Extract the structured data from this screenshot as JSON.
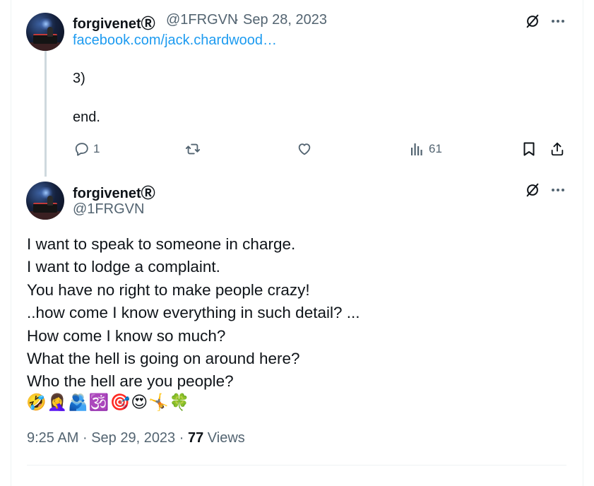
{
  "reply_tweet": {
    "display_name": "forgivenetⓇ",
    "handle": "@1FRGVN",
    "separator": "·",
    "date": "Sep 28, 2023",
    "link": "facebook.com/jack.chardwood…",
    "lines": [
      "3)",
      "end."
    ],
    "actions": {
      "replies": "1",
      "retweets": "",
      "likes": "",
      "views": "61"
    }
  },
  "main_tweet": {
    "display_name": "forgivenetⓇ",
    "handle": "@1FRGVN",
    "lines": [
      "I want to speak to someone in charge.",
      "I want to lodge a complaint.",
      "You have no right to make people crazy!",
      "..how come I know everything in such detail?   ...",
      "How come I know so much?",
      "What the hell is going on around here?",
      "Who the hell are  you people?"
    ],
    "emojis": "🤣🤦‍♀️🫂🕉️🎯😍🤸🍀",
    "time": "9:25 AM",
    "separator": "·",
    "date": "Sep 29, 2023",
    "views_count": "77",
    "views_label": "Views"
  },
  "icons": {
    "grok": "grok-icon",
    "more": "more-icon",
    "reply": "reply-icon",
    "retweet": "retweet-icon",
    "like": "like-icon",
    "views": "views-icon",
    "bookmark": "bookmark-icon",
    "share": "share-icon"
  },
  "colors": {
    "text": "#0f1419",
    "secondary": "#536471",
    "link": "#1d9bf0",
    "border": "#eff3f4",
    "thread_line": "#cfd9de"
  }
}
